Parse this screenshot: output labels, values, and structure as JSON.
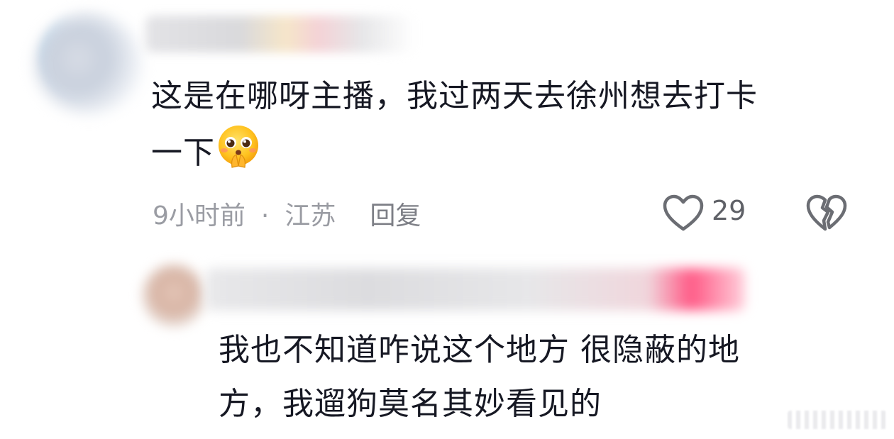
{
  "comment": {
    "text_line1": "这是在哪呀主播，我过两天去徐州想去打卡",
    "text_line2": "一下",
    "emoji_icon": "pleading-hands-emoji",
    "time": "9小时前",
    "separator": "·",
    "location": "江苏",
    "reply_label": "回复",
    "like_count": "29"
  },
  "reply": {
    "text_line1": "我也不知道咋说这个地方 很隐蔽的地",
    "text_line2": "方，我遛狗莫名其妙看见的"
  },
  "colors": {
    "text": "#161823",
    "meta": "#9a9ca3",
    "icon": "#6b6d73"
  }
}
